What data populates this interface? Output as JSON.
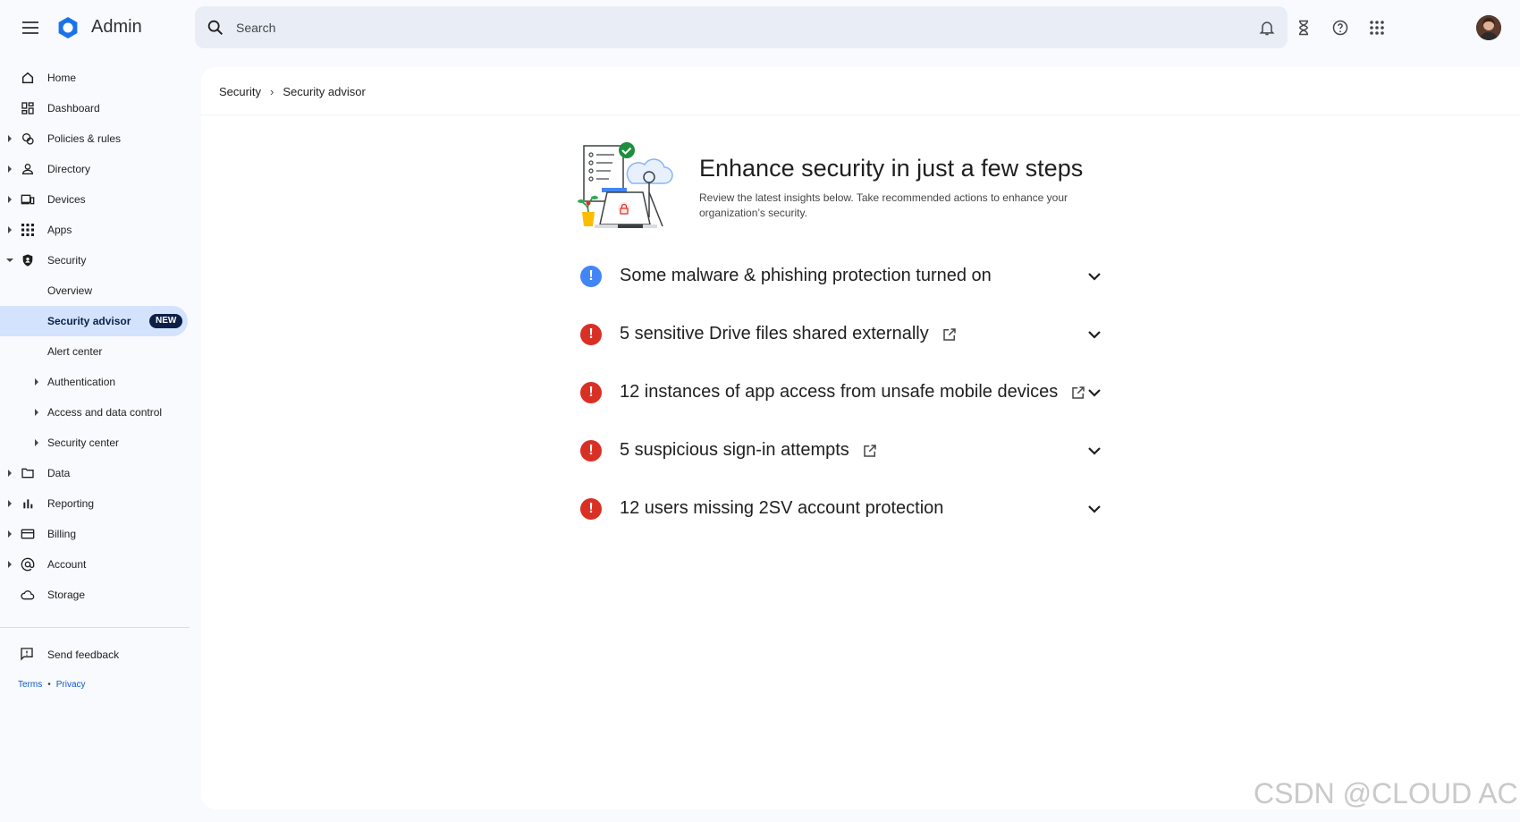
{
  "app": {
    "title": "Admin"
  },
  "search": {
    "placeholder": "Search"
  },
  "sidebar": {
    "items": [
      {
        "label": "Home",
        "icon": "home-icon"
      },
      {
        "label": "Dashboard",
        "icon": "dashboard-icon"
      },
      {
        "label": "Policies & rules",
        "icon": "policies-icon"
      },
      {
        "label": "Directory",
        "icon": "person-icon"
      },
      {
        "label": "Devices",
        "icon": "devices-icon"
      },
      {
        "label": "Apps",
        "icon": "apps-grid-icon"
      },
      {
        "label": "Security",
        "icon": "shield-icon"
      },
      {
        "label": "Overview"
      },
      {
        "label": "Security advisor",
        "badge": "NEW"
      },
      {
        "label": "Alert center"
      },
      {
        "label": "Authentication"
      },
      {
        "label": "Access and data control"
      },
      {
        "label": "Security center"
      },
      {
        "label": "Data",
        "icon": "folder-icon"
      },
      {
        "label": "Reporting",
        "icon": "bar-chart-icon"
      },
      {
        "label": "Billing",
        "icon": "credit-card-icon"
      },
      {
        "label": "Account",
        "icon": "at-sign-icon"
      },
      {
        "label": "Storage",
        "icon": "cloud-icon"
      }
    ],
    "feedback": "Send feedback",
    "terms": "Terms",
    "privacy": "Privacy"
  },
  "breadcrumb": {
    "parent": "Security",
    "current": "Security advisor"
  },
  "hero": {
    "title": "Enhance security in just a few steps",
    "subtitle": "Review the latest insights below. Take recommended actions to enhance your organization’s security."
  },
  "insights": [
    {
      "text": "Some malware & phishing protection turned on",
      "status": "info"
    },
    {
      "text": "5 sensitive Drive files shared externally",
      "status": "critical"
    },
    {
      "text": "12 instances of app access from unsafe mobile devices",
      "status": "critical"
    },
    {
      "text": "5 suspicious sign-in attempts",
      "status": "critical"
    },
    {
      "text": "12 users missing 2SV account protection",
      "status": "critical"
    }
  ],
  "colors": {
    "info": "#4285f4",
    "critical": "#d93025",
    "active_nav": "#d3e3fd",
    "brand": "#1a73e8"
  },
  "watermark": "CSDN @CLOUD ACE"
}
